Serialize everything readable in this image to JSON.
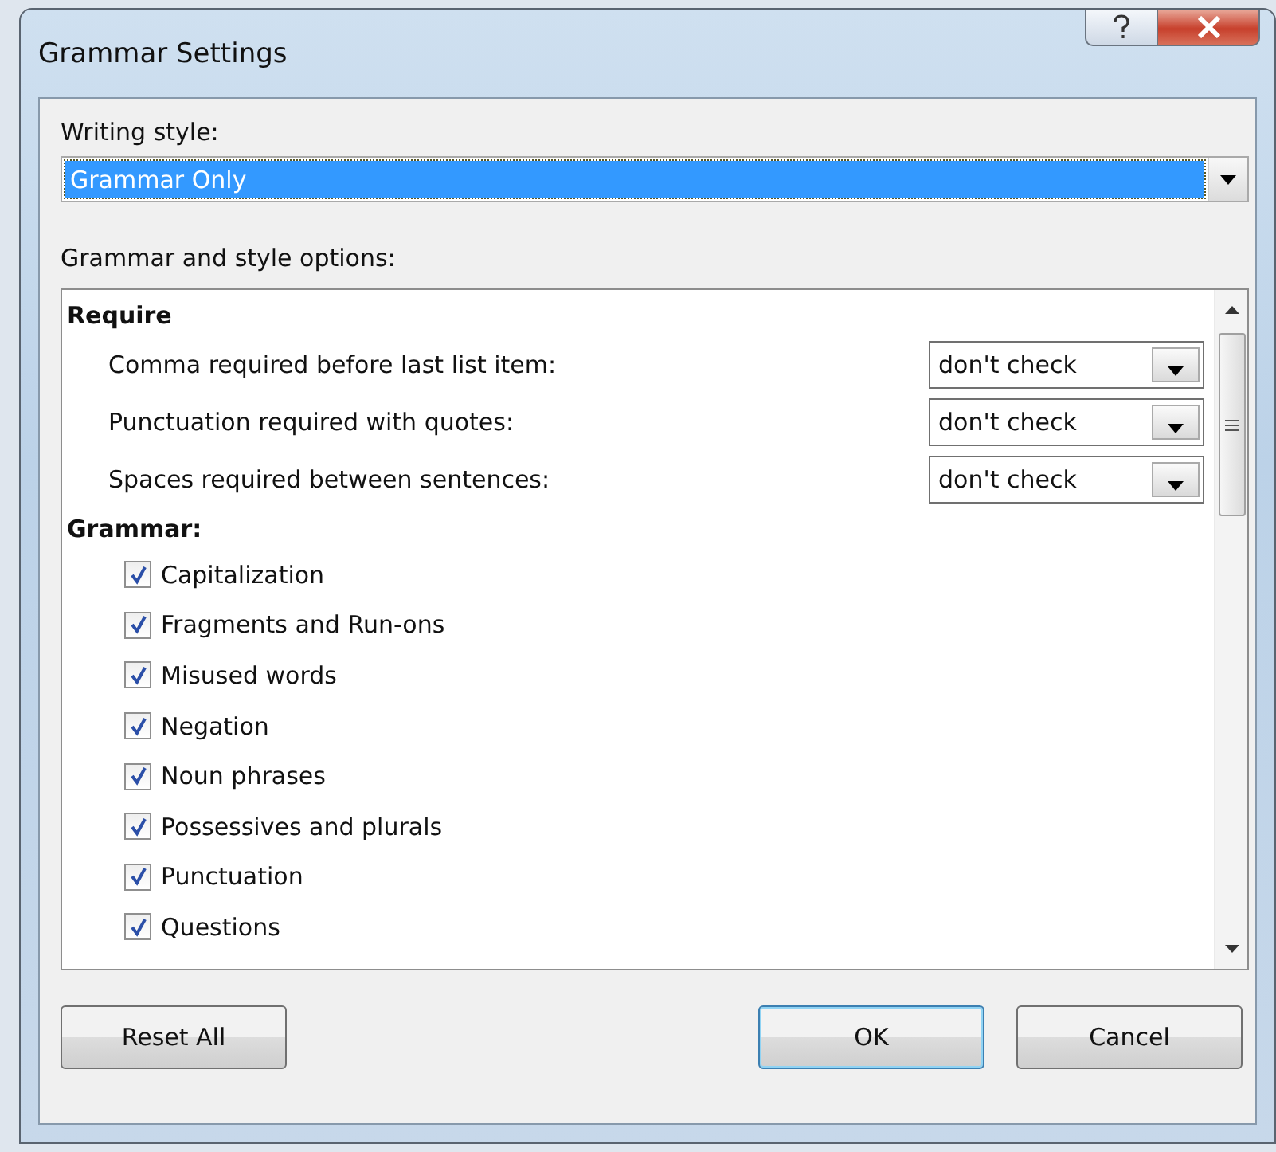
{
  "window": {
    "title": "Grammar Settings"
  },
  "writing_style": {
    "label": "Writing style:",
    "value": "Grammar Only",
    "selected": true
  },
  "options": {
    "label": "Grammar and style options:",
    "sections": [
      {
        "kind": "dropdowns",
        "heading": "Require",
        "items": [
          {
            "label": "Comma required before last list item:",
            "value": "don't check"
          },
          {
            "label": "Punctuation required with quotes:",
            "value": "don't check"
          },
          {
            "label": "Spaces required between sentences:",
            "value": "don't check"
          }
        ]
      },
      {
        "kind": "checkboxes",
        "heading": "Grammar:",
        "items": [
          {
            "label": "Capitalization",
            "checked": true
          },
          {
            "label": "Fragments and Run-ons",
            "checked": true
          },
          {
            "label": "Misused words",
            "checked": true
          },
          {
            "label": "Negation",
            "checked": true
          },
          {
            "label": "Noun phrases",
            "checked": true
          },
          {
            "label": "Possessives and plurals",
            "checked": true
          },
          {
            "label": "Punctuation",
            "checked": true
          },
          {
            "label": "Questions",
            "checked": true
          }
        ]
      }
    ]
  },
  "buttons": [
    {
      "label": "Reset All",
      "kind": "left",
      "default": false
    },
    {
      "label": "OK",
      "kind": "right",
      "default": true
    },
    {
      "label": "Cancel",
      "kind": "right",
      "default": false
    }
  ]
}
